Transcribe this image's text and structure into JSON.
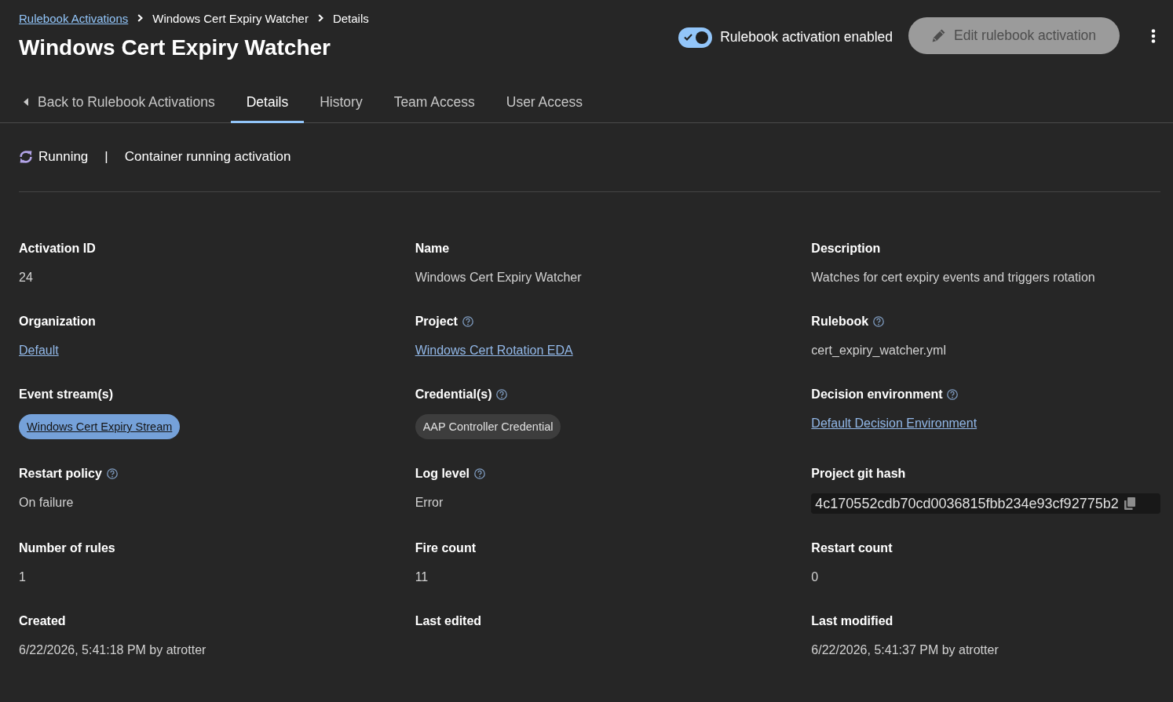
{
  "breadcrumb": [
    {
      "label": "Rulebook Activations",
      "kind": "link"
    },
    {
      "label": "Windows Cert Expiry Watcher",
      "kind": "text"
    },
    {
      "label": "Details",
      "kind": "text"
    }
  ],
  "title": "Windows Cert Expiry Watcher",
  "enable_switch": {
    "label": "Rulebook activation enabled",
    "on": true
  },
  "edit_button": {
    "label": "Edit rulebook activation",
    "disabled": true
  },
  "tabs": [
    {
      "label": "Back to Rulebook Activations",
      "kind": "back",
      "selected": false
    },
    {
      "label": "Details",
      "kind": "tab",
      "selected": true
    },
    {
      "label": "History",
      "kind": "tab",
      "selected": false
    },
    {
      "label": "Team Access",
      "kind": "tab",
      "selected": false
    },
    {
      "label": "User Access",
      "kind": "tab",
      "selected": false
    }
  ],
  "status": {
    "label": "Running",
    "separator": "|",
    "message": "Container running activation"
  },
  "details": [
    {
      "label": "Activation ID",
      "help": false,
      "kind": "text",
      "value": "24"
    },
    {
      "label": "Name",
      "help": false,
      "kind": "text",
      "value": "Windows Cert Expiry Watcher"
    },
    {
      "label": "Description",
      "help": false,
      "kind": "text",
      "value": "Watches for cert expiry events and triggers rotation"
    },
    {
      "label": "Organization",
      "help": false,
      "kind": "link",
      "value": "Default"
    },
    {
      "label": "Project",
      "help": true,
      "kind": "link",
      "value": "Windows Cert Rotation EDA"
    },
    {
      "label": "Rulebook",
      "help": true,
      "kind": "text",
      "value": "cert_expiry_watcher.yml"
    },
    {
      "label": "Event stream(s)",
      "help": false,
      "kind": "link-chip",
      "value": "Windows Cert Expiry Stream"
    },
    {
      "label": "Credential(s)",
      "help": true,
      "kind": "chip",
      "value": "AAP Controller Credential"
    },
    {
      "label": "Decision environment",
      "help": true,
      "kind": "link",
      "value": "Default Decision Environment"
    },
    {
      "label": "Restart policy",
      "help": true,
      "kind": "text",
      "value": "On failure"
    },
    {
      "label": "Log level",
      "help": true,
      "kind": "text",
      "value": "Error"
    },
    {
      "label": "Project git hash",
      "help": false,
      "kind": "code",
      "value": "4c170552cdb70cd0036815fbb234e93cf92775b2"
    },
    {
      "label": "Number of rules",
      "help": false,
      "kind": "text",
      "value": "1"
    },
    {
      "label": "Fire count",
      "help": false,
      "kind": "text",
      "value": "11"
    },
    {
      "label": "Restart count",
      "help": false,
      "kind": "text",
      "value": "0"
    },
    {
      "label": "Created",
      "help": false,
      "kind": "text",
      "value": "6/22/2026, 5:41:18 PM by atrotter"
    },
    {
      "label": "Last edited",
      "help": false
    },
    {
      "label": "Last modified",
      "help": false,
      "kind": "text",
      "value": "6/22/2026, 5:41:37 PM by atrotter"
    }
  ]
}
